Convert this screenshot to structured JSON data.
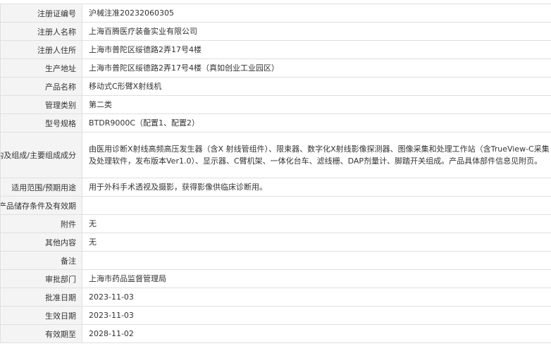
{
  "rows": [
    {
      "label": "注册证编号",
      "value": "沪械注准20232060305"
    },
    {
      "label": "注册人名称",
      "value": "上海百腾医疗装备实业有限公司"
    },
    {
      "label": "注册人住所",
      "value": "上海市普陀区绥德路2弄17号4楼"
    },
    {
      "label": "生产地址",
      "value": "上海市普陀区绥德路2弄17号4楼（真如创业工业园区）"
    },
    {
      "label": "产品名称",
      "value": "移动式C形臂X射线机"
    },
    {
      "label": "管理类别",
      "value": "第二类"
    },
    {
      "label": "型号规格",
      "value": "BTDR9000C（配置1、配置2）"
    },
    {
      "label": "结构及组成/主要组成成分",
      "value": "由医用诊断X射线高频高压发生器（含X 射线管组件）、限束器、数字化X射线影像探测器、图像采集和处理工作站（含TrueView-C采集及处理软件，发布版本Ver1.0）、显示器、C臂机架、一体化台车、滤线栅、DAP剂量计、脚踏开关组成。产品具体部件信息见附页。"
    },
    {
      "label": "适用范围/预期用途",
      "value": "用于外科手术透视及摄影，获得影像供临床诊断用。"
    },
    {
      "label": "产品储存条件及有效期",
      "value": ""
    },
    {
      "label": "附件",
      "value": "无"
    },
    {
      "label": "其他内容",
      "value": "无"
    },
    {
      "label": "备注",
      "value": ""
    },
    {
      "label": "审批部门",
      "value": "上海市药品监督管理局"
    },
    {
      "label": "批准日期",
      "value": "2023-11-03"
    },
    {
      "label": "生效日期",
      "value": "2023-11-03"
    },
    {
      "label": "有效期至",
      "value": "2028-11-02"
    }
  ]
}
